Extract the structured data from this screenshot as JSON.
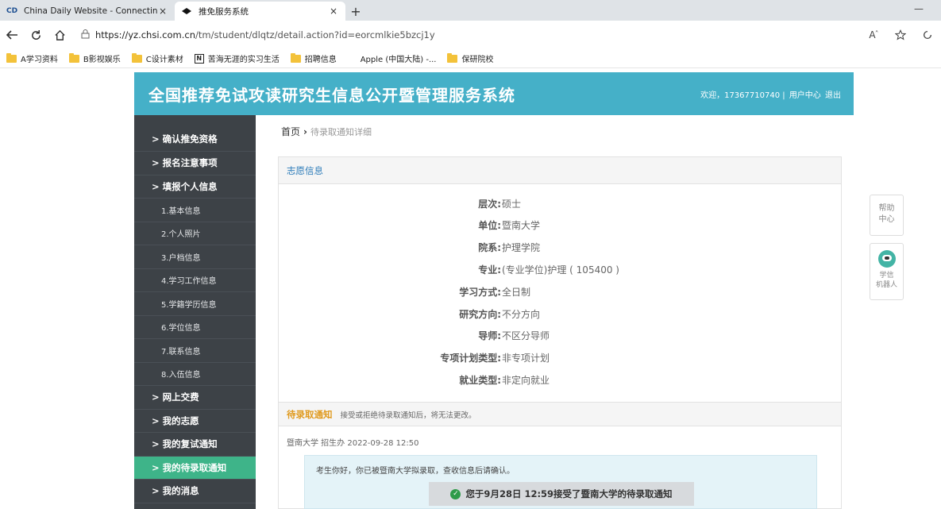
{
  "browser": {
    "tabs": [
      {
        "title": "China Daily Website - Connectin",
        "active": false,
        "favicon": "CD"
      },
      {
        "title": "推免服务系统",
        "active": true,
        "favicon": "chsi-icon"
      }
    ],
    "url_host": "https://yz.chsi.com.cn",
    "url_path": "/tm/student/dlqtz/detail.action?id=eorcmlkie5bzcj1y",
    "bookmarks": [
      "A学习资料",
      "B影视娱乐",
      "C设计素材",
      "苦海无涯的实习生活",
      "招聘信息",
      "Apple (中国大陆) -...",
      "保研院校"
    ],
    "new_tab_symbol": "+",
    "close_symbol": "×",
    "minimize_symbol": "—"
  },
  "header": {
    "title": "全国推荐免试攻读研究生信息公开暨管理服务系统",
    "welcome": "欢迎，17367710740 |",
    "user_center": "用户中心",
    "logout": "退出",
    "bg_color": "#45b0c8"
  },
  "sidebar": {
    "items": [
      {
        "label": "> 确认推免资格",
        "type": "main"
      },
      {
        "label": "> 报名注意事项",
        "type": "main"
      },
      {
        "label": "> 填报个人信息",
        "type": "main"
      },
      {
        "label": "1.基本信息",
        "type": "sub"
      },
      {
        "label": "2.个人照片",
        "type": "sub"
      },
      {
        "label": "3.户档信息",
        "type": "sub"
      },
      {
        "label": "4.学习工作信息",
        "type": "sub"
      },
      {
        "label": "5.学籍学历信息",
        "type": "sub"
      },
      {
        "label": "6.学位信息",
        "type": "sub"
      },
      {
        "label": "7.联系信息",
        "type": "sub"
      },
      {
        "label": "8.入伍信息",
        "type": "sub"
      },
      {
        "label": "> 网上交费",
        "type": "main"
      },
      {
        "label": "> 我的志愿",
        "type": "main"
      },
      {
        "label": "> 我的复试通知",
        "type": "main"
      },
      {
        "label": "> 我的待录取通知",
        "type": "main",
        "active": true
      },
      {
        "label": "> 我的消息",
        "type": "main"
      }
    ],
    "active_color": "#3eb489"
  },
  "breadcrumb": {
    "home": "首页",
    "separator": "›",
    "current": "待录取通知详细"
  },
  "application_info": {
    "section_title": "志愿信息",
    "fields": [
      {
        "label": "层次:",
        "value": "硕士"
      },
      {
        "label": "单位:",
        "value": "暨南大学"
      },
      {
        "label": "院系:",
        "value": "护理学院"
      },
      {
        "label": "专业:",
        "value": "(专业学位)护理 ( 105400 )"
      },
      {
        "label": "学习方式:",
        "value": "全日制"
      },
      {
        "label": "研究方向:",
        "value": "不分方向"
      },
      {
        "label": "导师:",
        "value": "不区分导师"
      },
      {
        "label": "专项计划类型:",
        "value": "非专项计划"
      },
      {
        "label": "就业类型:",
        "value": "非定向就业"
      }
    ]
  },
  "admission_notice": {
    "title": "待录取通知",
    "tip": "接受或拒绝待录取通知后，将无法更改。",
    "meta": "暨南大学 招生办 2022-09-28 12:50",
    "message": "考生你好，你已被暨南大学拟录取，查收信息后请确认。",
    "accepted_text": "您于9月28日 12:59接受了暨南大学的待录取通知",
    "title_color": "#e09a1e"
  },
  "floating": {
    "help_line1": "帮助",
    "help_line2": "中心",
    "robot_line1": "学信",
    "robot_line2": "机器人"
  }
}
